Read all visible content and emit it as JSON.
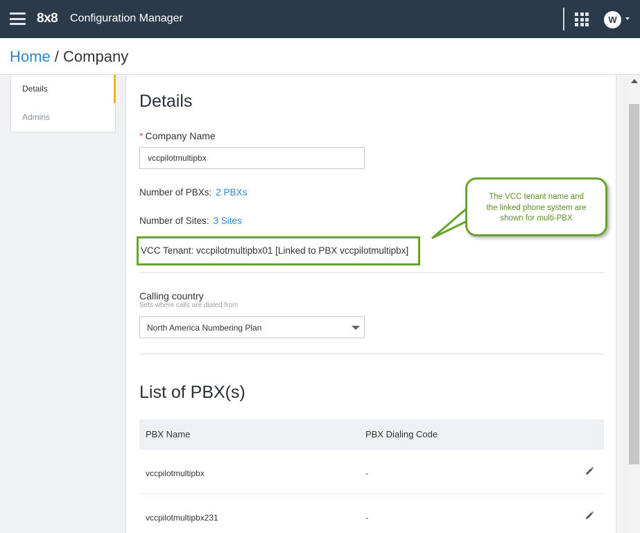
{
  "app": {
    "brand": "8x8",
    "title": "Configuration Manager",
    "avatar_initials": "W"
  },
  "breadcrumb": {
    "home": "Home",
    "separator": " / ",
    "current": "Company"
  },
  "sidebar": {
    "items": [
      {
        "label": "Details",
        "active": true
      },
      {
        "label": "Admins",
        "active": false
      }
    ]
  },
  "details": {
    "heading": "Details",
    "company_name_label": "Company Name",
    "required_marker": "*",
    "company_name_value": "vccpilotmultipbx",
    "pbx_count_label": "Number of PBXs:",
    "pbx_count_link": "2 PBXs",
    "site_count_label": "Number of Sites:",
    "site_count_link": "3 Sites",
    "vcc_tenant_text": "VCC Tenant: vccpilotmultipbx01 [Linked to PBX vccpilotmultipbx]",
    "calling_country_label": "Calling country",
    "calling_country_hint": "Sets where calls are dialed from",
    "calling_country_value": "North America Numbering Plan"
  },
  "pbx_list": {
    "heading": "List of PBX(s)",
    "columns": [
      "PBX Name",
      "PBX Dialing Code"
    ],
    "rows": [
      {
        "name": "vccpilotmultipbx",
        "dialing_code": "-"
      },
      {
        "name": "vccpilotmultipbx231",
        "dialing_code": "-"
      }
    ]
  },
  "callout": {
    "text_lines": [
      "The VCC tenant name and",
      "the linked phone system are",
      "shown for multi-PBX"
    ]
  },
  "colors": {
    "topbar": "#2b3a4b",
    "link": "#2f86c9",
    "active_nav_accent": "#f6b21a",
    "annotation_green": "#66a42e",
    "required": "#d9534f"
  }
}
